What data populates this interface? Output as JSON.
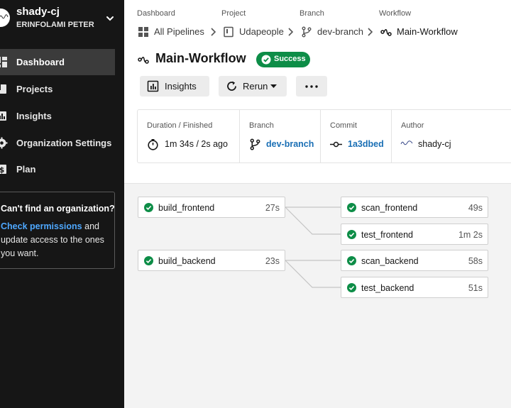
{
  "sidebar": {
    "org_name": "shady-cj",
    "org_user": "ERINFOLAMI PETER",
    "nav": [
      {
        "label": "Dashboard",
        "icon": "dashboard-icon",
        "active": true
      },
      {
        "label": "Projects",
        "icon": "projects-icon",
        "active": false
      },
      {
        "label": "Insights",
        "icon": "insights-icon",
        "active": false
      },
      {
        "label": "Organization Settings",
        "icon": "gear-icon",
        "active": false
      },
      {
        "label": "Plan",
        "icon": "dollar-icon",
        "active": false
      }
    ],
    "notice": {
      "title": "Can't find an organization?",
      "link": "Check permissions",
      "text1": " and",
      "text2": "update access to the ones",
      "text3": "you want."
    }
  },
  "breadcrumb": {
    "labels": [
      "Dashboard",
      "Project",
      "Branch",
      "Workflow"
    ],
    "items": [
      {
        "label": "All Pipelines",
        "icon": "grid-icon"
      },
      {
        "label": "Udapeople",
        "icon": "repo-icon"
      },
      {
        "label": "dev-branch",
        "icon": "branch-icon"
      },
      {
        "label": "Main-Workflow",
        "icon": "workflow-icon"
      }
    ]
  },
  "workflow": {
    "title": "Main-Workflow",
    "status": "Success"
  },
  "actions": {
    "insights_label": "Insights",
    "rerun_label": "Rerun"
  },
  "info": {
    "duration_label": "Duration / Finished",
    "duration_value": "1m 34s / 2s ago",
    "branch_label": "Branch",
    "branch_value": "dev-branch",
    "commit_label": "Commit",
    "commit_value": "1a3dbed",
    "author_label": "Author",
    "author_value": "shady-cj"
  },
  "jobs": {
    "build_frontend": {
      "name": "build_frontend",
      "duration": "27s",
      "status": "success"
    },
    "scan_frontend": {
      "name": "scan_frontend",
      "duration": "49s",
      "status": "success"
    },
    "test_frontend": {
      "name": "test_frontend",
      "duration": "1m 2s",
      "status": "success"
    },
    "build_backend": {
      "name": "build_backend",
      "duration": "23s",
      "status": "success"
    },
    "scan_backend": {
      "name": "scan_backend",
      "duration": "58s",
      "status": "success"
    },
    "test_backend": {
      "name": "test_backend",
      "duration": "51s",
      "status": "success"
    }
  },
  "colors": {
    "sidebar_bg": "#161616",
    "success": "#0d8d47",
    "link": "#1a6fb5",
    "graph_bg": "#f3f3f3"
  }
}
